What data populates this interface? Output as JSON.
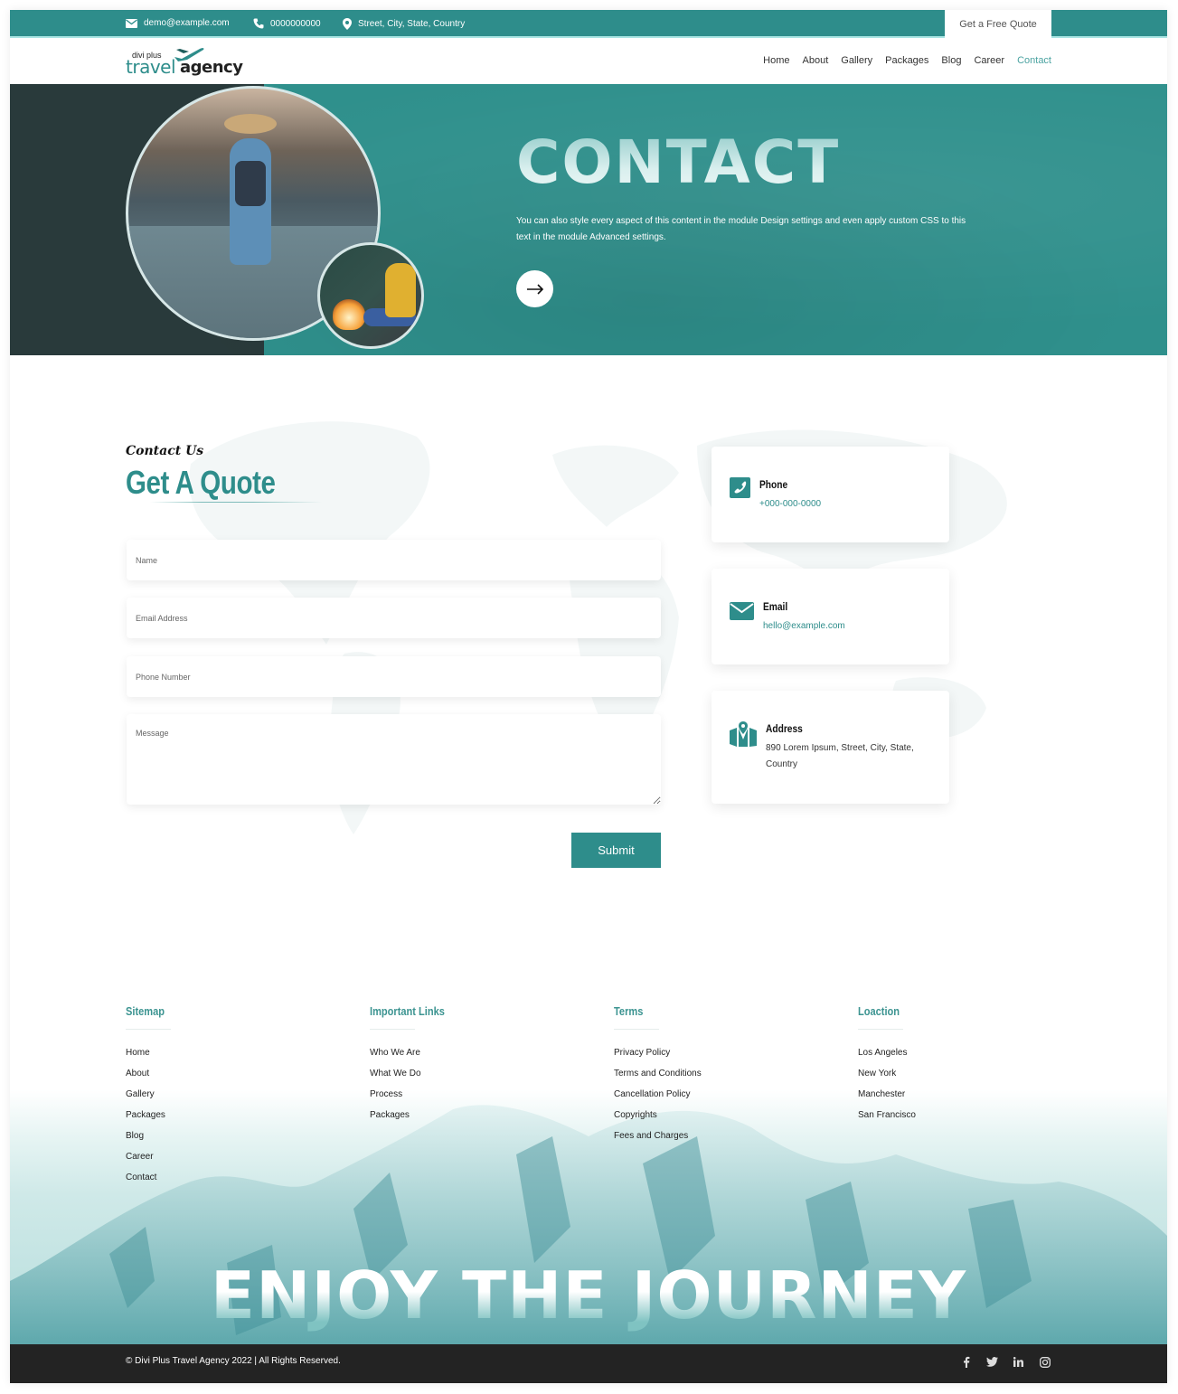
{
  "topbar": {
    "email": "demo@example.com",
    "phone": "0000000000",
    "address": "Street, City, State, Country",
    "cta_label": "Get a Free Quote"
  },
  "header": {
    "logo": {
      "small": "divi plus",
      "primary": "travel",
      "secondary": "agency"
    },
    "nav": [
      {
        "label": "Home",
        "active": false
      },
      {
        "label": "About",
        "active": false
      },
      {
        "label": "Gallery",
        "active": false
      },
      {
        "label": "Packages",
        "active": false
      },
      {
        "label": "Blog",
        "active": false
      },
      {
        "label": "Career",
        "active": false
      },
      {
        "label": "Contact",
        "active": true
      }
    ]
  },
  "hero": {
    "title": "CONTACT",
    "description": "You can also style every aspect of this content in the module Design settings and even apply custom CSS to this text in the module Advanced settings.",
    "arrow_icon": "arrow-right-icon"
  },
  "contact_section": {
    "eyebrow": "Contact Us",
    "title": "Get A Quote",
    "form": {
      "name_placeholder": "Name",
      "email_placeholder": "Email Address",
      "phone_placeholder": "Phone Number",
      "message_placeholder": "Message",
      "name_value": "",
      "email_value": "",
      "phone_value": "",
      "message_value": "",
      "submit_label": "Submit"
    },
    "cards": [
      {
        "icon": "phone-icon",
        "title": "Phone",
        "value": "+000-000-0000"
      },
      {
        "icon": "email-icon",
        "title": "Email",
        "value": "hello@example.com"
      },
      {
        "icon": "map-icon",
        "title": "Address",
        "value": "890 Lorem Ipsum, Street, City, State, Country"
      }
    ]
  },
  "footer": {
    "columns": [
      {
        "heading": "Sitemap",
        "links": [
          "Home",
          "About",
          "Gallery",
          "Packages",
          "Blog",
          "Career",
          "Contact"
        ]
      },
      {
        "heading": "Important Links",
        "links": [
          "Who We Are",
          "What We Do",
          "Process",
          "Packages"
        ]
      },
      {
        "heading": "Terms",
        "links": [
          "Privacy Policy",
          "Terms and Conditions",
          "Cancellation Policy",
          "Copyrights",
          "Fees and Charges"
        ]
      },
      {
        "heading": "Loaction",
        "links": [
          "Los Angeles",
          "New York",
          "Manchester",
          "San Francisco"
        ]
      }
    ],
    "slogan": "ENJOY THE JOURNEY",
    "copyright": "© Divi Plus Travel Agency 2022 | All Rights Reserved.",
    "socials": [
      {
        "icon": "facebook-icon",
        "glyph": "f"
      },
      {
        "icon": "twitter-icon",
        "glyph": "t"
      },
      {
        "icon": "linkedin-icon",
        "glyph": "in"
      },
      {
        "icon": "instagram-icon",
        "glyph": "◎"
      }
    ]
  },
  "colors": {
    "brand": "#2e8d8b",
    "dark_panel": "#293a3b",
    "bottom_bar": "#232323",
    "nav_active": "#4ba3a1"
  }
}
